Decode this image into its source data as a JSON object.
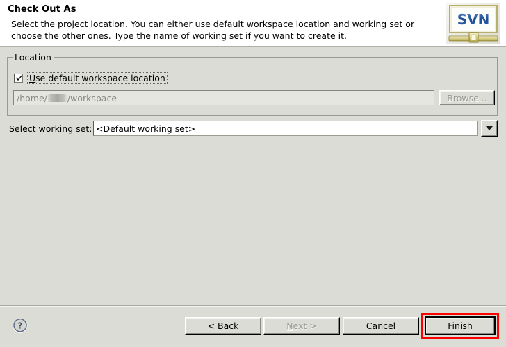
{
  "header": {
    "title": "Check Out As",
    "description": "Select the project location. You can either use default workspace location and working set or choose the other ones. Type the name of working set if you want to create it.",
    "logo_text": "SVN",
    "logo_icon": "svn-banner-icon"
  },
  "location_group": {
    "legend": "Location",
    "checkbox": {
      "label_before": "U",
      "label_after": "se default workspace location",
      "checked": true,
      "icon": "checkmark-icon"
    },
    "path_field": {
      "value_prefix": "/home/",
      "value_suffix": "/workspace",
      "redacted": true,
      "enabled": false
    },
    "browse_button": {
      "label": "Browse...",
      "enabled": false
    }
  },
  "working_set": {
    "label_before": "Select ",
    "label_mnemonic": "w",
    "label_after": "orking set:",
    "value": "<Default working set>",
    "dropdown_icon": "chevron-down-icon"
  },
  "footer": {
    "help_icon": "question-mark-icon",
    "buttons": [
      {
        "name": "back",
        "label_before": "< ",
        "mnemonic": "B",
        "label_after": "ack",
        "enabled": true,
        "default": false
      },
      {
        "name": "next",
        "label_before": "",
        "mnemonic": "N",
        "label_after": "ext >",
        "enabled": false,
        "default": false
      },
      {
        "name": "cancel",
        "label_before": "Cancel",
        "mnemonic": "",
        "label_after": "",
        "enabled": true,
        "default": false
      },
      {
        "name": "finish",
        "label_before": "",
        "mnemonic": "F",
        "label_after": "inish",
        "enabled": true,
        "default": true
      }
    ]
  },
  "annotation": {
    "highlight_target": "finish-button",
    "color": "#ff0000"
  }
}
